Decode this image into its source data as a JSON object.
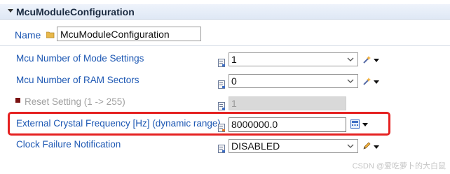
{
  "section": {
    "title": "McuModuleConfiguration"
  },
  "name_field": {
    "label": "Name",
    "value": "McuModuleConfiguration"
  },
  "rows": [
    {
      "label": "Mcu Number of Mode Settings",
      "value": "1",
      "control": "combo",
      "edit_icon": "wand-icon"
    },
    {
      "label": "Mcu Number of RAM Sectors",
      "value": "0",
      "control": "combo",
      "edit_icon": "wand-icon"
    },
    {
      "label": "Reset Setting (1 -> 255)",
      "value": "1",
      "control": "disabled-text"
    },
    {
      "label": "External Crystal Frequency [Hz] (dynamic range)",
      "value": "8000000.0",
      "control": "text",
      "edit_icon": "calculator-icon"
    },
    {
      "label": "Clock Failure Notification",
      "value": "DISABLED",
      "control": "combo",
      "edit_icon": "pencil-icon"
    }
  ],
  "watermark": "CSDN @爱吃萝卜的大白鼠",
  "colors": {
    "label_link": "#1c57b3",
    "highlight": "#e52121",
    "header_bg": "#dfe8f5",
    "disabled_bg": "#d9d9d9"
  }
}
